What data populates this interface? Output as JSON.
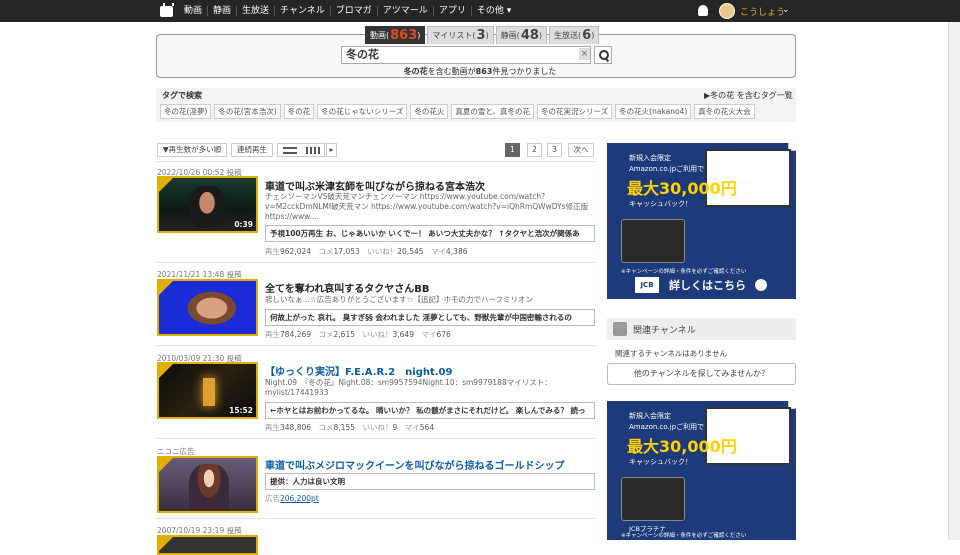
{
  "topnav": {
    "items": [
      "動画",
      "静画",
      "生放送",
      "チャンネル",
      "ブロマガ",
      "アツマール",
      "アプリ",
      "その他 ▾"
    ],
    "username": "こうしょう",
    "user_caret": "⌄"
  },
  "search": {
    "tabs": [
      {
        "label": "動画(",
        "count": "863",
        "suffix": ")"
      },
      {
        "label": "マイリスト(",
        "count": "3",
        "suffix": ")"
      },
      {
        "label": "静画(",
        "count": "48",
        "suffix": ")"
      },
      {
        "label": "生放送(",
        "count": "6",
        "suffix": ")"
      }
    ],
    "query": "冬の花",
    "clear": "×",
    "result_query": "冬の花",
    "result_mid": "を含む動画が",
    "result_count": "863",
    "result_end": "件見つかりました"
  },
  "tags": {
    "heading": "タグで検索",
    "related_link": "▶冬の花 を含むタグ一覧",
    "items": [
      "冬の花(淫夢)",
      "冬の花(宮本浩次)",
      "冬の花",
      "冬の花じゃないシリーズ",
      "冬の花火",
      "真夏の雪と、真冬の花",
      "冬の花実況シリーズ",
      "冬の花火(nakano4)",
      "真冬の花火大会"
    ]
  },
  "toolbar": {
    "sort": "▼再生数が多い順",
    "continuous": "連続再生",
    "more": "▸"
  },
  "pagination": {
    "pages": [
      "1",
      "2",
      "3"
    ],
    "next": "次へ"
  },
  "videos": [
    {
      "date": "2022/10/26 00:52",
      "post": "投稿",
      "title": "車道で叫ぶ米津玄師を叫びながら掠ねる宮本浩次",
      "duration": "0:39",
      "desc": "チェンソーマンVS破天荒マンチェンソーマン https://www.youtube.com/watch?v=M2cckDmNLMI破天荒マン https://www.youtube.com/watch?v=iQhRmQWwDYs修正版 https://www....",
      "comment": "予視100万再生 お、じゃあいいか いくでー！ あいつ大丈夫かな？ ↑タクヤと浩次が関係あ",
      "views": "962,024",
      "comments": "17,053",
      "likes": "20,545",
      "mylists": "4,386"
    },
    {
      "date": "2021/11/21 13:48",
      "post": "投稿",
      "title": "全てを奪われ哀叫するタクヤさんBB",
      "duration": "",
      "desc": "悲しいなぁ…☆広告ありがとうございます☆【追記】ホモの力でハーフミリオン",
      "comment": "何故上がった 哀れ。 臭すぎ§§ 会われました 淫夢としても、野獣先輩が中国密輸されるの",
      "views": "784,269",
      "comments": "2,615",
      "likes": "3,649",
      "mylists": "676"
    },
    {
      "date": "2010/03/09 21:30",
      "post": "投稿",
      "title": "【ゆっくり実況】F.E.A.R.2　night.09",
      "duration": "15:52",
      "desc": "Night.09　『冬の花』Night.08：sm9957594Night.10：sm9979188マイリスト：mylist/17441933",
      "comment": "←ホヤとはお前わかってるな。 晴いいか？ 私の髄がまさにそれだけど。 楽しんでみる？ 読っ",
      "views": "348,806",
      "comments": "8,155",
      "likes": "9",
      "mylists": "564"
    }
  ],
  "ad_item": {
    "label": "ニコニ広告",
    "title": "車道で叫ぶメジロマックイーンを叫びながら掠ねるゴールドシップ",
    "comment": "提供：人力は良い文明",
    "points_label": "広告",
    "points": "206,200pt"
  },
  "last_date": "2007/10/19 23:19",
  "last_post": "投稿",
  "stat_labels": {
    "views": "再生",
    "comments": "コメ",
    "likes": "いいね！",
    "mylists": "マイ"
  },
  "side_ad": {
    "l1": "新規入会限定",
    "l2": "Amazon.co.jpご利用で",
    "l3": "最大30,000円",
    "l4": "キャッシュバック！",
    "l5": "JCBプラチナ",
    "l6": "※キャンペーンの詳細・条件を必ずご確認ください",
    "jcb": "JCB",
    "cta": "詳しくはこちら"
  },
  "channel": {
    "title": "関連チャンネル",
    "none": "関連するチャンネルはありません",
    "button": "他のチャンネルを探してみませんか？"
  }
}
